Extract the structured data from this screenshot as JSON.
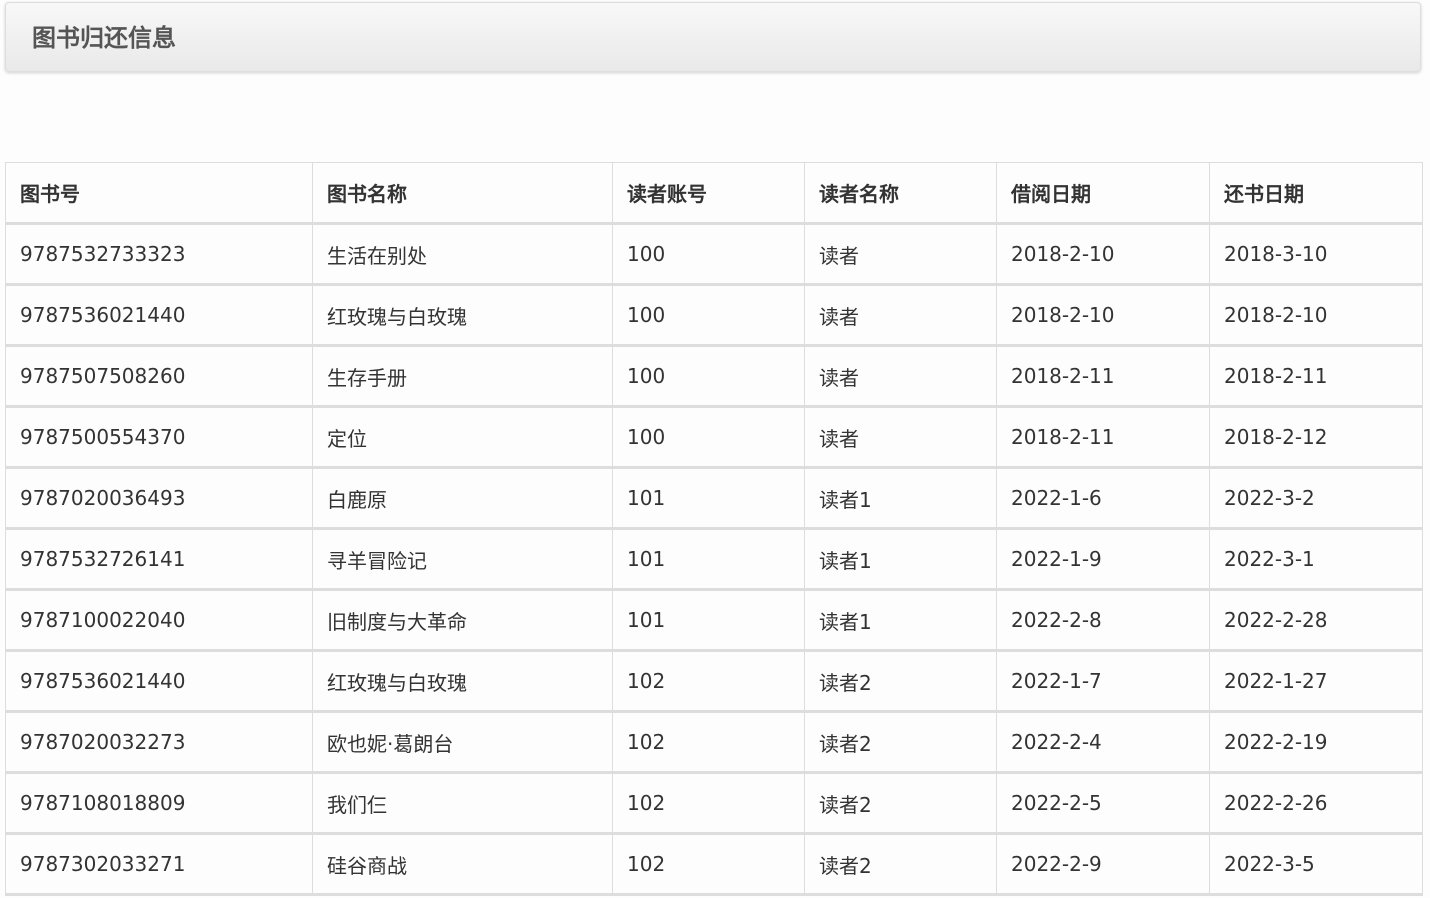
{
  "header": {
    "title": "图书归还信息"
  },
  "table": {
    "columns": [
      "图书号",
      "图书名称",
      "读者账号",
      "读者名称",
      "借阅日期",
      "还书日期"
    ],
    "rows": [
      [
        "9787532733323",
        "生活在别处",
        "100",
        "读者",
        "2018-2-10",
        "2018-3-10"
      ],
      [
        "9787536021440",
        "红玫瑰与白玫瑰",
        "100",
        "读者",
        "2018-2-10",
        "2018-2-10"
      ],
      [
        "9787507508260",
        "生存手册",
        "100",
        "读者",
        "2018-2-11",
        "2018-2-11"
      ],
      [
        "9787500554370",
        "定位",
        "100",
        "读者",
        "2018-2-11",
        "2018-2-12"
      ],
      [
        "9787020036493",
        "白鹿原",
        "101",
        "读者1",
        "2022-1-6",
        "2022-3-2"
      ],
      [
        "9787532726141",
        "寻羊冒险记",
        "101",
        "读者1",
        "2022-1-9",
        "2022-3-1"
      ],
      [
        "9787100022040",
        "旧制度与大革命",
        "101",
        "读者1",
        "2022-2-8",
        "2022-2-28"
      ],
      [
        "9787536021440",
        "红玫瑰与白玫瑰",
        "102",
        "读者2",
        "2022-1-7",
        "2022-1-27"
      ],
      [
        "9787020032273",
        "欧也妮·葛朗台",
        "102",
        "读者2",
        "2022-2-4",
        "2022-2-19"
      ],
      [
        "9787108018809",
        "我们仨",
        "102",
        "读者2",
        "2022-2-5",
        "2022-2-26"
      ],
      [
        "9787302033271",
        "硅谷商战",
        "102",
        "读者2",
        "2022-2-9",
        "2022-3-5"
      ]
    ]
  }
}
